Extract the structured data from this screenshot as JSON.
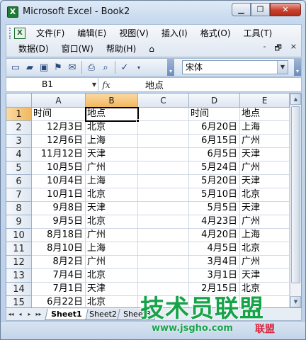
{
  "window": {
    "title": "Microsoft Excel - Book2",
    "minimize": "▁",
    "restore": "❐",
    "close": "✕"
  },
  "menu": {
    "row1": [
      "文件(F)",
      "编辑(E)",
      "视图(V)",
      "插入(I)",
      "格式(O)",
      "工具(T)"
    ],
    "row2": [
      "数据(D)",
      "窗口(W)",
      "帮助(H)"
    ],
    "doc_controls": [
      "-",
      "🗗",
      "×"
    ]
  },
  "toolbar": {
    "font_name": "宋体"
  },
  "formula_bar": {
    "name_box": "B1",
    "fx": "fx",
    "value": "地点"
  },
  "grid": {
    "columns": [
      "A",
      "B",
      "C",
      "D",
      "E"
    ],
    "selected_column": "B",
    "selected_row": 1,
    "rows": [
      {
        "n": "1",
        "a": "时间",
        "b": "地点",
        "c": "",
        "d": "时间",
        "e": "地点"
      },
      {
        "n": "2",
        "a": "12月3日",
        "b": "北京",
        "c": "",
        "d": "6月20日",
        "e": "上海"
      },
      {
        "n": "3",
        "a": "12月6日",
        "b": "上海",
        "c": "",
        "d": "6月15日",
        "e": "广州"
      },
      {
        "n": "4",
        "a": "11月12日",
        "b": "天津",
        "c": "",
        "d": "6月5日",
        "e": "天津"
      },
      {
        "n": "5",
        "a": "10月5日",
        "b": "广州",
        "c": "",
        "d": "5月24日",
        "e": "广州"
      },
      {
        "n": "6",
        "a": "10月4日",
        "b": "上海",
        "c": "",
        "d": "5月20日",
        "e": "天津"
      },
      {
        "n": "7",
        "a": "10月1日",
        "b": "北京",
        "c": "",
        "d": "5月10日",
        "e": "北京"
      },
      {
        "n": "8",
        "a": "9月8日",
        "b": "天津",
        "c": "",
        "d": "5月5日",
        "e": "天津"
      },
      {
        "n": "9",
        "a": "9月5日",
        "b": "北京",
        "c": "",
        "d": "4月23日",
        "e": "广州"
      },
      {
        "n": "10",
        "a": "8月18日",
        "b": "广州",
        "c": "",
        "d": "4月20日",
        "e": "上海"
      },
      {
        "n": "11",
        "a": "8月10日",
        "b": "上海",
        "c": "",
        "d": "4月5日",
        "e": "北京"
      },
      {
        "n": "12",
        "a": "8月2日",
        "b": "广州",
        "c": "",
        "d": "3月4日",
        "e": "广州"
      },
      {
        "n": "13",
        "a": "7月4日",
        "b": "北京",
        "c": "",
        "d": "3月1日",
        "e": "天津"
      },
      {
        "n": "14",
        "a": "7月1日",
        "b": "天津",
        "c": "",
        "d": "2月15日",
        "e": "北京"
      },
      {
        "n": "15",
        "a": "6月22日",
        "b": "北京",
        "c": "",
        "d": "",
        "e": ""
      }
    ]
  },
  "sheets": [
    "Sheet1",
    "Sheet2",
    "Sheet3"
  ],
  "sheet_nav": [
    "◂◂",
    "◂",
    "▸",
    "▸▸"
  ],
  "watermark": {
    "big": "技术员联盟",
    "url": "www.jsgho.com",
    "logo": "联盟"
  },
  "colors": {
    "selected_header": "#f1b85f",
    "watermark_green": "#17a34a"
  }
}
